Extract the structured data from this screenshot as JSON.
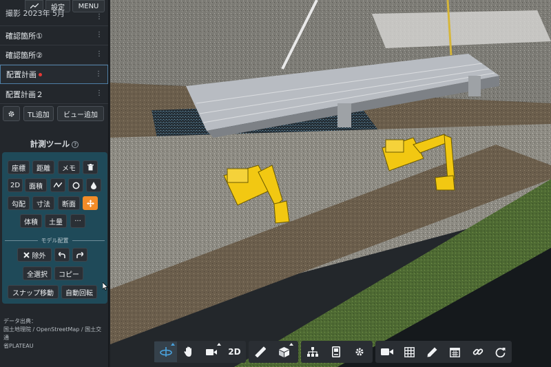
{
  "topbar": {
    "trend_icon": "trend-icon",
    "settings_label": "設定",
    "menu_label": "MENU"
  },
  "layers": [
    {
      "label": "撮影 2023年 5月",
      "active": false
    },
    {
      "label": "確認箇所①",
      "active": false
    },
    {
      "label": "確認箇所②",
      "active": false
    },
    {
      "label": "配置計画",
      "active": true,
      "dot_color": "#e53935"
    },
    {
      "label": "配置計画２",
      "active": false
    }
  ],
  "actions": {
    "gear_icon": "gear-icon",
    "add_tl_label": "TL追加",
    "add_view_label": "ビュー追加"
  },
  "measure": {
    "title": "計測ツール",
    "help_icon": "help-icon",
    "tools": {
      "coords": "座標",
      "distance": "距離",
      "memo": "メモ",
      "delete_icon": "trash-icon",
      "twod": "2D",
      "area": "面積",
      "line_icon": "polyline-icon",
      "circle_icon": "circle-icon",
      "drop_icon": "drop-icon",
      "slope": "勾配",
      "dimension": "寸法",
      "section": "断面",
      "move_icon": "move-icon",
      "volume": "体積",
      "earthwork": "土量",
      "more": "···"
    },
    "model_section_label": "モデル配置",
    "model": {
      "exclude_label": "除外",
      "undo_icon": "undo-icon",
      "redo_icon": "redo-icon",
      "select_all_label": "全選択",
      "copy_label": "コピー",
      "snap_move_label": "スナップ移動",
      "auto_rotate_label": "自動回転"
    },
    "accent_color": "#f28c28",
    "panel_color": "#1f4a59"
  },
  "credits": {
    "line1": "データ出典：",
    "line2": "国土地理院 / OpenStreetMap / 国土交通",
    "line3": "省PLATEAU"
  },
  "bottom_toolbar": {
    "group1": [
      "orbit-icon",
      "pan-hand-icon",
      "camera-mode-icon",
      "2D"
    ],
    "group2": [
      "ruler-icon",
      "box-icon"
    ],
    "group3": [
      "hierarchy-icon",
      "device-icon",
      "gear-icon"
    ],
    "group4": [
      "video-icon",
      "grid-icon",
      "pencil-icon",
      "calendar-icon",
      "link-icon",
      "refresh-icon"
    ],
    "twod_label": "2D",
    "selected_color": "#4aa3df"
  }
}
